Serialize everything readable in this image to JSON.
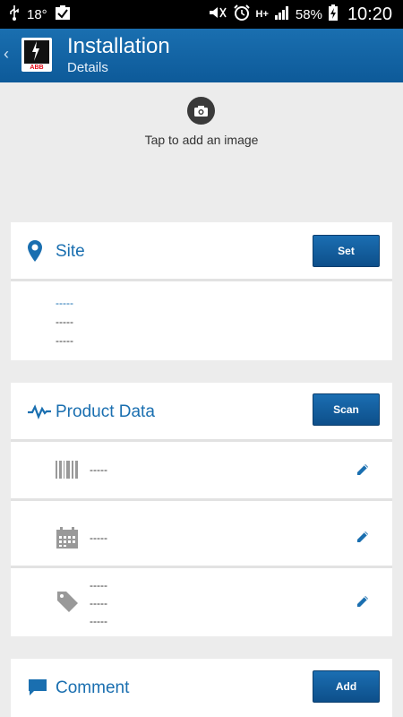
{
  "status_bar": {
    "temperature": "18°",
    "battery": "58%",
    "time": "10:20",
    "network": "H+"
  },
  "header": {
    "back_icon": "‹",
    "title": "Installation",
    "subtitle": "Details",
    "logo_text": "ABB"
  },
  "image_area": {
    "hint": "Tap to add an image"
  },
  "site": {
    "title": "Site",
    "button": "Set",
    "lines": [
      "-----",
      "-----",
      "-----"
    ]
  },
  "product_data": {
    "title": "Product Data",
    "button": "Scan",
    "barcode_value": "-----",
    "date_value": "-----",
    "tag_values": [
      "-----",
      "-----",
      "-----"
    ]
  },
  "comment": {
    "title": "Comment",
    "button": "Add"
  },
  "colors": {
    "accent": "#1a6fb0",
    "header": "#0d5a99",
    "background": "#ececec"
  }
}
